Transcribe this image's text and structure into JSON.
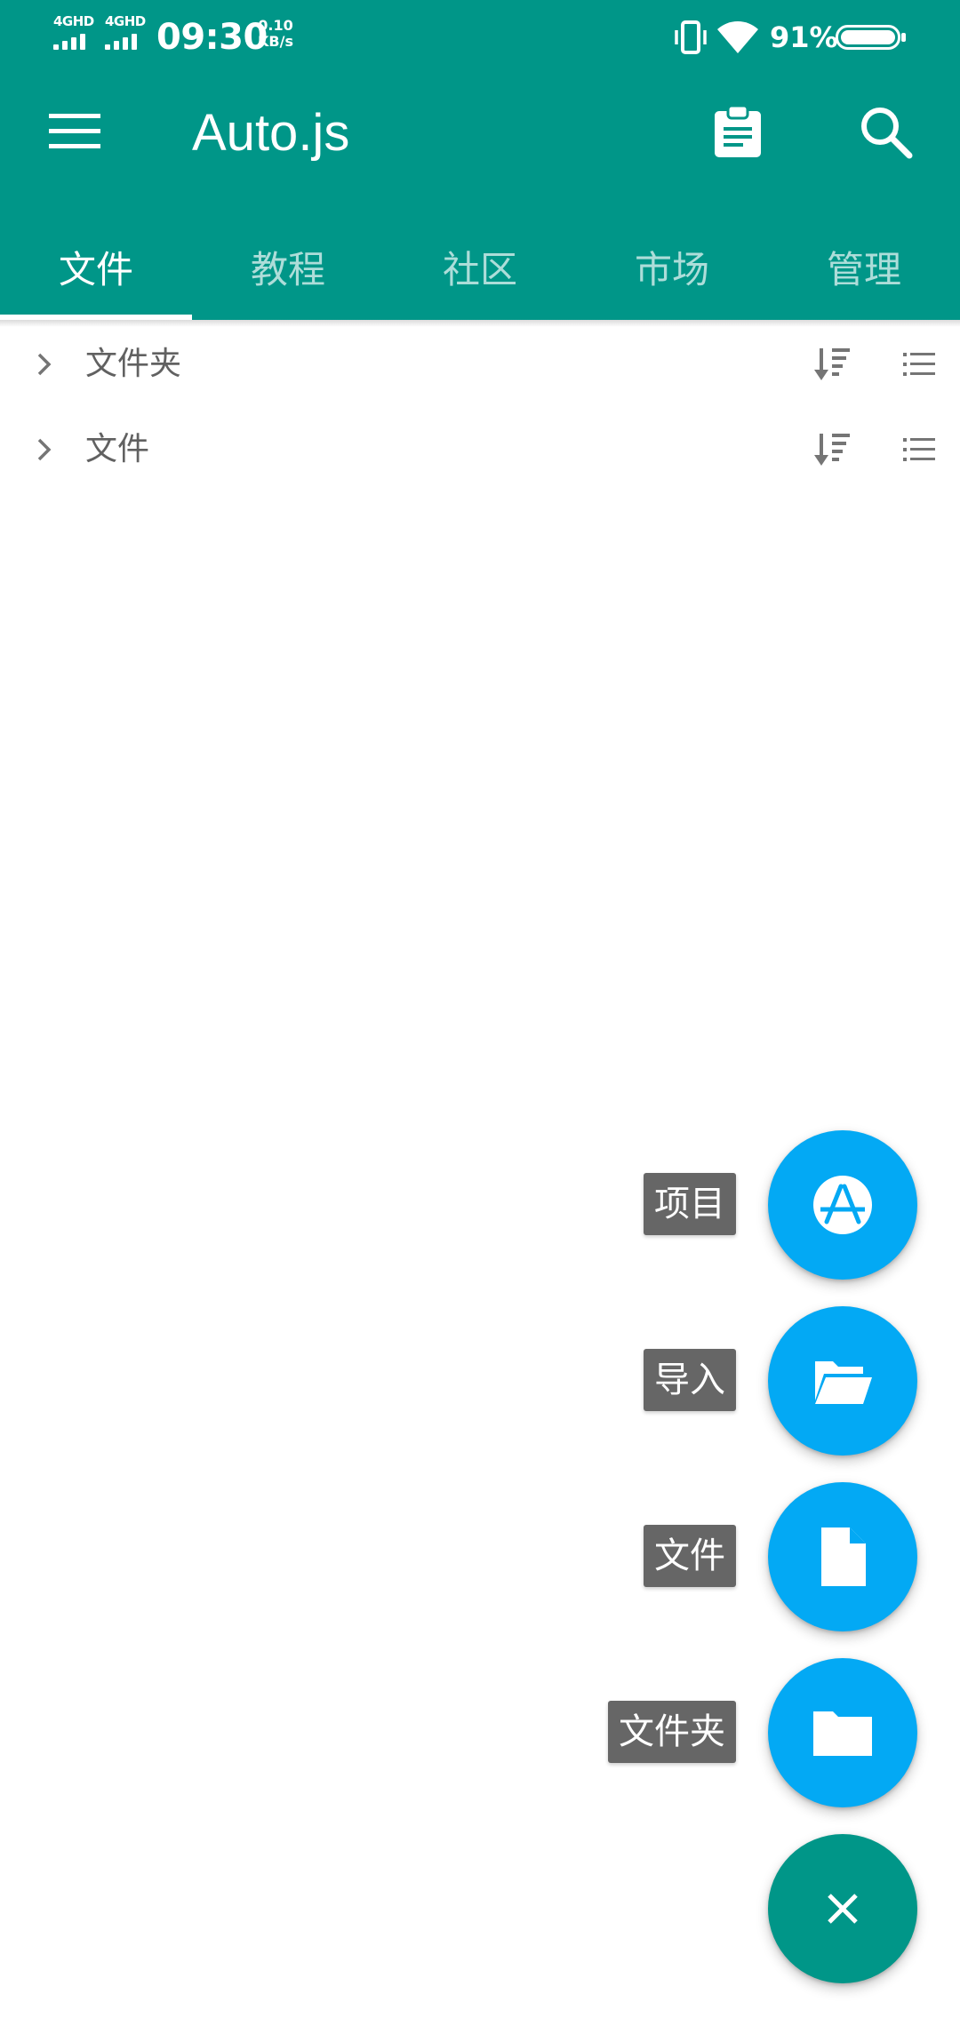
{
  "status_bar": {
    "network_1": "4GHD",
    "network_2": "4GHD",
    "time": "09:30",
    "speed_value": "0.10",
    "speed_unit": "KB/s",
    "battery": "91%"
  },
  "toolbar": {
    "title": "Auto.js",
    "menu_icon": "menu-icon",
    "clipboard_icon": "clipboard-icon",
    "search_icon": "search-icon"
  },
  "tabs": [
    {
      "label": "文件",
      "active": true
    },
    {
      "label": "教程",
      "active": false
    },
    {
      "label": "社区",
      "active": false
    },
    {
      "label": "市场",
      "active": false
    },
    {
      "label": "管理",
      "active": false
    }
  ],
  "sections": [
    {
      "label": "文件夹"
    },
    {
      "label": "文件"
    }
  ],
  "speed_dial": {
    "items": [
      {
        "label": "项目",
        "icon": "project-icon"
      },
      {
        "label": "导入",
        "icon": "folder-open-icon"
      },
      {
        "label": "文件",
        "icon": "file-icon"
      },
      {
        "label": "文件夹",
        "icon": "folder-icon"
      }
    ],
    "close_icon": "close-icon"
  },
  "colors": {
    "primary": "#009688",
    "fab_blue": "#03a9f4",
    "label_bg": "#666666",
    "text_gray": "#616161"
  }
}
